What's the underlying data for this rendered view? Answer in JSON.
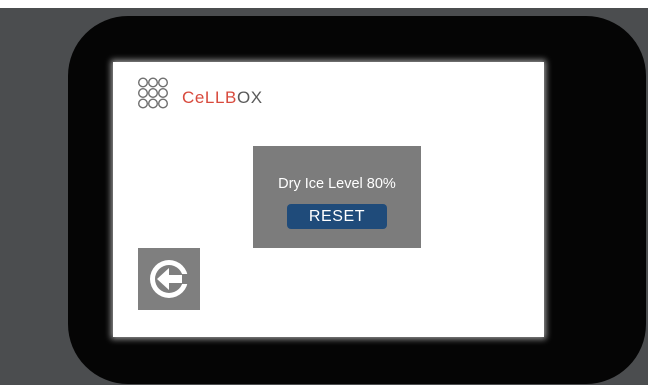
{
  "brand": {
    "name_part1": "CeLLB",
    "name_part2": "OX"
  },
  "dialog": {
    "message": "Dry Ice Level 80%",
    "reset_label": "RESET"
  },
  "icons": {
    "logo": "cellbox-dots-logo-icon",
    "back": "back-arrow-icon"
  },
  "colors": {
    "background": "#4b4d4f",
    "bezel": "#050505",
    "screen": "#ffffff",
    "dialog": "#7c7c7c",
    "reset_button": "#1f4b7a",
    "brand_red": "#d84a3d",
    "brand_grey": "#5a5a5a",
    "back_button": "#7f7f7f"
  }
}
